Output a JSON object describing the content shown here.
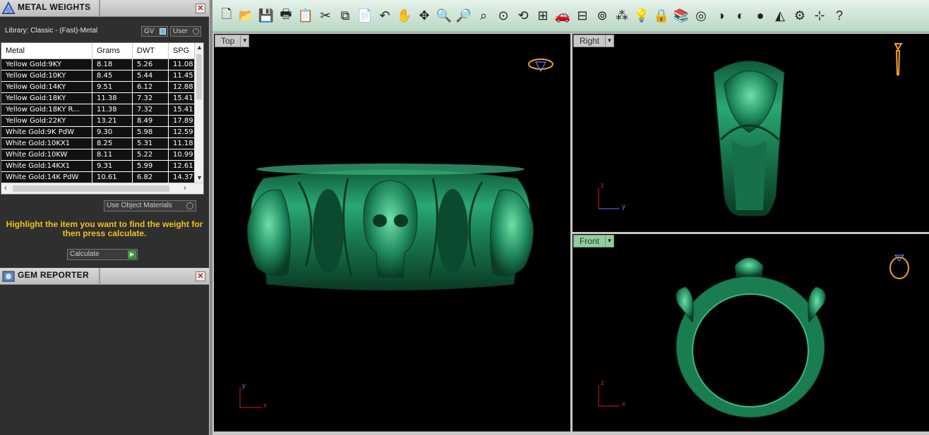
{
  "metal_panel": {
    "title": "METAL WEIGHTS",
    "close": "✕",
    "library_label": "Library: Classic - (Fast)-Metal",
    "gv_label": "GV",
    "user_label": "User",
    "columns": [
      "Metal",
      "Grams",
      "DWT",
      "SPG"
    ],
    "rows": [
      [
        "Yellow Gold:9KY",
        "8.18",
        "5.26",
        "11.08"
      ],
      [
        "Yellow Gold:10KY",
        "8.45",
        "5.44",
        "11.45"
      ],
      [
        "Yellow Gold:14KY",
        "9.51",
        "6.12",
        "12.88"
      ],
      [
        "Yellow Gold:18KY",
        "11.38",
        "7.32",
        "15.41"
      ],
      [
        "Yellow Gold:18KY R...",
        "11.38",
        "7.32",
        "15.41"
      ],
      [
        "Yellow Gold:22KY",
        "13.21",
        "8.49",
        "17.89"
      ],
      [
        "White Gold:9K PdW",
        "9.30",
        "5.98",
        "12.59"
      ],
      [
        "White Gold:10KX1",
        "8.25",
        "5.31",
        "11.18"
      ],
      [
        "White Gold:10KW",
        "8.11",
        "5.22",
        "10.99"
      ],
      [
        "White Gold:14KX1",
        "9.31",
        "5.99",
        "12.61"
      ],
      [
        "White Gold:14K PdW",
        "10.61",
        "6.82",
        "14.37"
      ]
    ],
    "use_object_materials": "Use Object Materials",
    "hint": "Highlight the item you want to find the weight for then press calculate.",
    "calculate": "Calculate"
  },
  "gem_panel": {
    "title": "GEM REPORTER",
    "close": "✕"
  },
  "toolbar_icons": [
    "new-icon",
    "open-icon",
    "save-icon",
    "print-icon",
    "paste-special-icon",
    "cut-icon",
    "copy-icon",
    "paste-icon",
    "undo-icon",
    "pan-hand-icon",
    "rotate-view-icon",
    "zoom-in-icon",
    "zoom-window-icon",
    "zoom-extents-icon",
    "zoom-selected-icon",
    "rotate-camera-icon",
    "four-viewports-icon",
    "car-render-icon",
    "grid-icon",
    "snap-icon",
    "points-icon",
    "light-icon",
    "lock-icon",
    "layers-icon",
    "color-wheel-icon",
    "shade-icon",
    "render-icon",
    "sphere-icon",
    "selection-icon",
    "settings-gear-icon",
    "dimension-icon",
    "help-icon"
  ],
  "toolbar_glyphs": [
    "🗋",
    "📂",
    "💾",
    "🖶",
    "📋",
    "✂",
    "⧉",
    "📄",
    "↶",
    "✋",
    "✥",
    "🔍",
    "🔎",
    "⌕",
    "⊙",
    "⟲",
    "⊞",
    "🚗",
    "⊟",
    "⊚",
    "⁂",
    "💡",
    "🔒",
    "📚",
    "◎",
    "◑",
    "◐",
    "●",
    "◭",
    "⚙",
    "⊹",
    "?"
  ],
  "viewports": {
    "top": {
      "label": "Top",
      "axis_v": "y",
      "axis_h": "x"
    },
    "right": {
      "label": "Right",
      "axis_v": "z",
      "axis_h": "y"
    },
    "front": {
      "label": "Front",
      "axis_v": "z",
      "axis_h": "x"
    }
  },
  "colors": {
    "ring": "#1f8a5e",
    "ring_light": "#4fd39a",
    "ring_dark": "#0b3d26",
    "hint": "#f0c020"
  }
}
